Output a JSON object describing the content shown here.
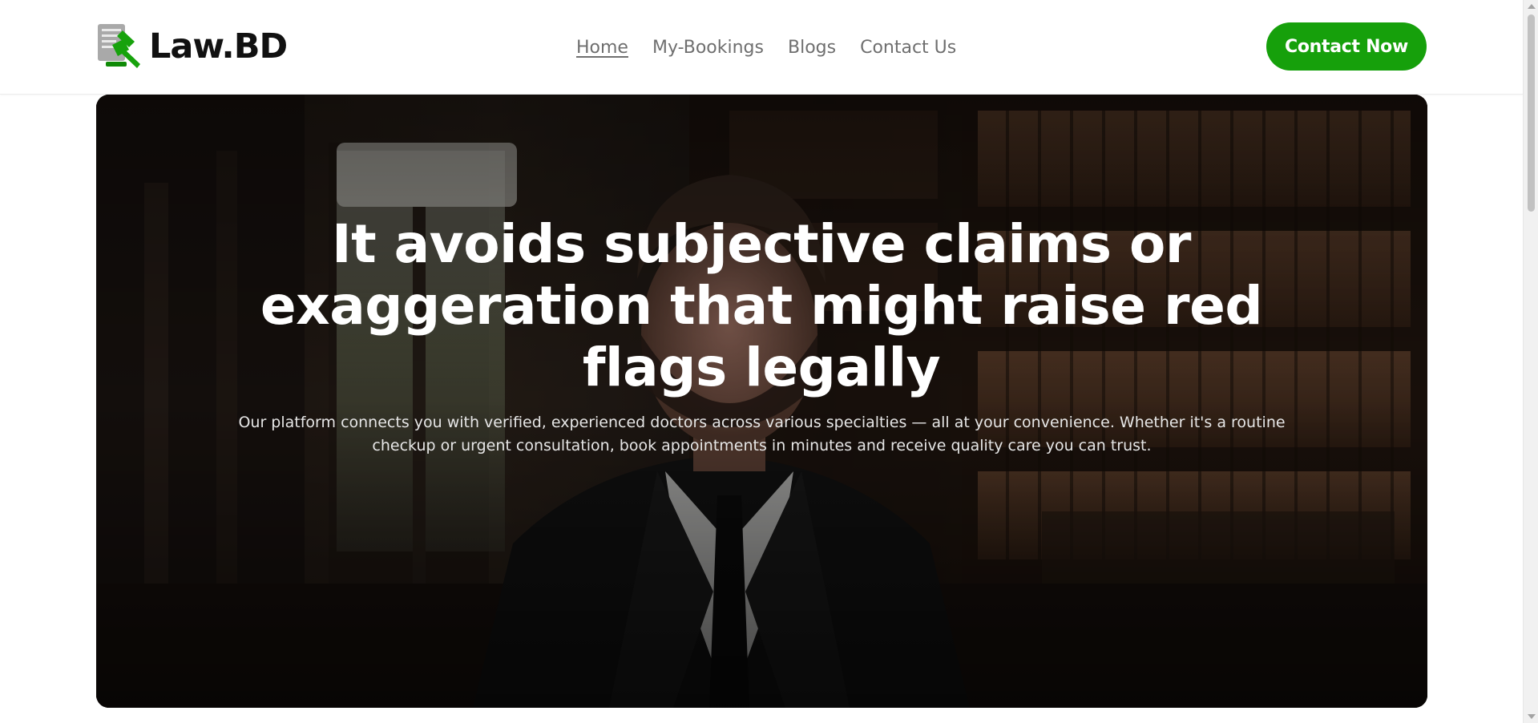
{
  "brand": {
    "name": "Law.BD",
    "icon": "gavel-document-logo-icon"
  },
  "nav": {
    "links": [
      {
        "label": "Home",
        "active": true
      },
      {
        "label": "My-Bookings",
        "active": false
      },
      {
        "label": "Blogs",
        "active": false
      },
      {
        "label": "Contact Us",
        "active": false
      }
    ]
  },
  "cta": {
    "label": "Contact Now"
  },
  "hero": {
    "title": "It avoids subjective claims or exaggeration that might raise red flags legally",
    "subtitle": "Our platform connects you with verified, experienced doctors across various specialties — all at your convenience. Whether it's a routine checkup or urgent consultation, book appointments in minutes and receive quality care you can trust.",
    "image": "lawyer-in-library-photo"
  },
  "colors": {
    "accent": "#16a00b",
    "nav_text": "#6f6f6f",
    "brand_text": "#111111",
    "hero_text": "#ffffff"
  }
}
